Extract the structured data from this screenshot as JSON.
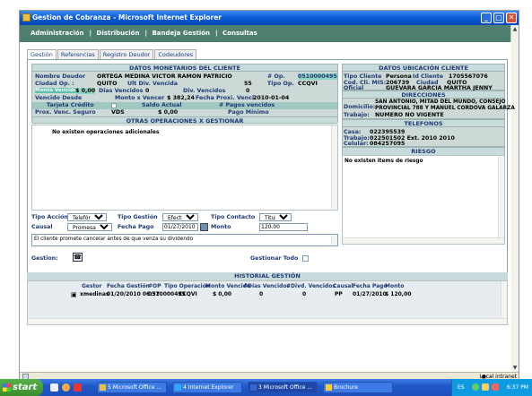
{
  "window": {
    "title": "Gestion de Cobranza - Microsoft Internet Explorer",
    "min": "_",
    "max": "□",
    "close": "✕"
  },
  "nav": {
    "items": [
      "Administración",
      "Distribución",
      "Bandeja Gestión",
      "Consultas"
    ],
    "sep": "|"
  },
  "tabs": [
    "Gestión",
    "Referencias",
    "Registro Deudor",
    "Codeudores"
  ],
  "monetarios": {
    "title": "DATOS MONETARIOS DEL CLIENTE",
    "nombre_lbl": "Nombre Deudor",
    "nombre_val": "ORTEGA MEDINA VICTOR RAMON PATRICIO",
    "op_lbl": "# Op.",
    "op_val": "0510000495",
    "ciudad_lbl": "Ciudad Op. :",
    "ciudad_val": "QUITO",
    "ult_lbl": "Ult Div. Vencida",
    "ult_val": "55",
    "tipoop_lbl": "Tipo Op.",
    "tipoop_val": "CCQVI",
    "montov_lbl": "Monto Vencido",
    "montov_val": "$ 0,00",
    "diasv_lbl": "Dias Vencidos",
    "diasv_val": "0",
    "divv_lbl": "Div. Vencidos",
    "divv_val": "0",
    "vdesde_lbl": "Vencido Desde",
    "mxv_lbl": "Monto x Vencer",
    "mxv_val": "$ 382,24",
    "fpv_lbl": "Fecha Proxi. Venci.",
    "fpv_val": "2010-01-04",
    "tc_lbl": "Tarjeta Crédito",
    "sa_lbl": "Saldo Actual",
    "pv_lbl": "# Pagos vencidos",
    "pvs_lbl": "Prox. Venc. Seguro",
    "vds_val": "VDS",
    "pvs_val": "$ 0,00",
    "pm_lbl": "Pago Mínimo"
  },
  "otras": {
    "title": "OTRAS OPERACIONES X GESTIONAR",
    "empty": "No existen operaciones adicionales"
  },
  "accion": {
    "ta_lbl": "Tipo Acción",
    "ta_val": "Telefónica",
    "tg_lbl": "Tipo Gestión",
    "tg_val": "Efectiva",
    "tc_lbl": "Tipo Contacto",
    "tc_val": "Titular",
    "causal_lbl": "Causal",
    "causal_val": "Promesa Pago",
    "fp_lbl": "Fecha Pago",
    "fp_val": "01/27/2010",
    "monto_lbl": "Monto",
    "monto_val": "120.00",
    "comentario": "El cliente promete cancelar antes de que venza su dividendo",
    "gestion_lbl": "Gestion:",
    "gestionar_todo_lbl": "Gestionar Todo"
  },
  "ubicacion": {
    "title": "DATOS UBICACIÓN CLIENTE",
    "tc_lbl": "Tipo Cliente",
    "tc_val": "Persona",
    "id_lbl": "Id Cliente",
    "id_val": "1705567076",
    "cod_lbl": "Cod. Cli. MIS:",
    "cod_val": "206739",
    "ciudad_lbl": "Ciudad",
    "ciudad_val": "QUITO",
    "oficial_lbl": "Oficial",
    "oficial_val": "GUEVARA GARCIA MARTHA JENNY"
  },
  "direcciones": {
    "title": "DIRECCIONES",
    "dom_lbl": "Domicilio:",
    "dom_val1": "SAN ANTONIO, MITAD DEL MUNDO, CONSEJO",
    "dom_val2": "PROVINCIAL 788 Y MANUEL CORDOVA GALARZA",
    "trab_lbl": "Trabajo:",
    "trab_val": "NUMERO NO VIGENTE"
  },
  "telefonos": {
    "title": "TELEFONOS",
    "casa_lbl": "Casa:",
    "casa_val": "022395539",
    "trab_lbl": "Trabajo:",
    "trab_val": "022501502 Ext. 2010 2010",
    "cel_lbl": "Celular:",
    "cel_val": "084257095"
  },
  "riesgo": {
    "title": "RIESGO",
    "empty": "No existen items de riesgo"
  },
  "historial": {
    "title": "HISTORIAL GESTIÓN",
    "headers": [
      "Gestor",
      "Fecha Gestión",
      "#OP",
      "Tipo Operación",
      "Monto Vencido",
      "#Días Vencidos",
      "#Divd. Vencidos",
      "Causal",
      "Fecha Pago",
      "Monto"
    ],
    "row": [
      "xmedinas",
      "01/20/2010 06:37",
      "0510000495",
      "CCQVI",
      "$ 0,00",
      "0",
      "0",
      "PP",
      "01/27/2010",
      "$ 120,00"
    ]
  },
  "status": {
    "zone": "Local intranet"
  },
  "taskbar": {
    "start": "start",
    "items": [
      "5 Microsoft Office ...",
      "4 Internet Explorer",
      "3 Microsoft Office ...",
      "Brochure"
    ],
    "tray_lang": "ES",
    "clock": "6:37 PM"
  },
  "colors": {
    "header_green": "#4f7f6f",
    "section_bg": "#ccd9d7",
    "label_blue": "#1f3a74",
    "highlight": "#8fd5c4"
  }
}
